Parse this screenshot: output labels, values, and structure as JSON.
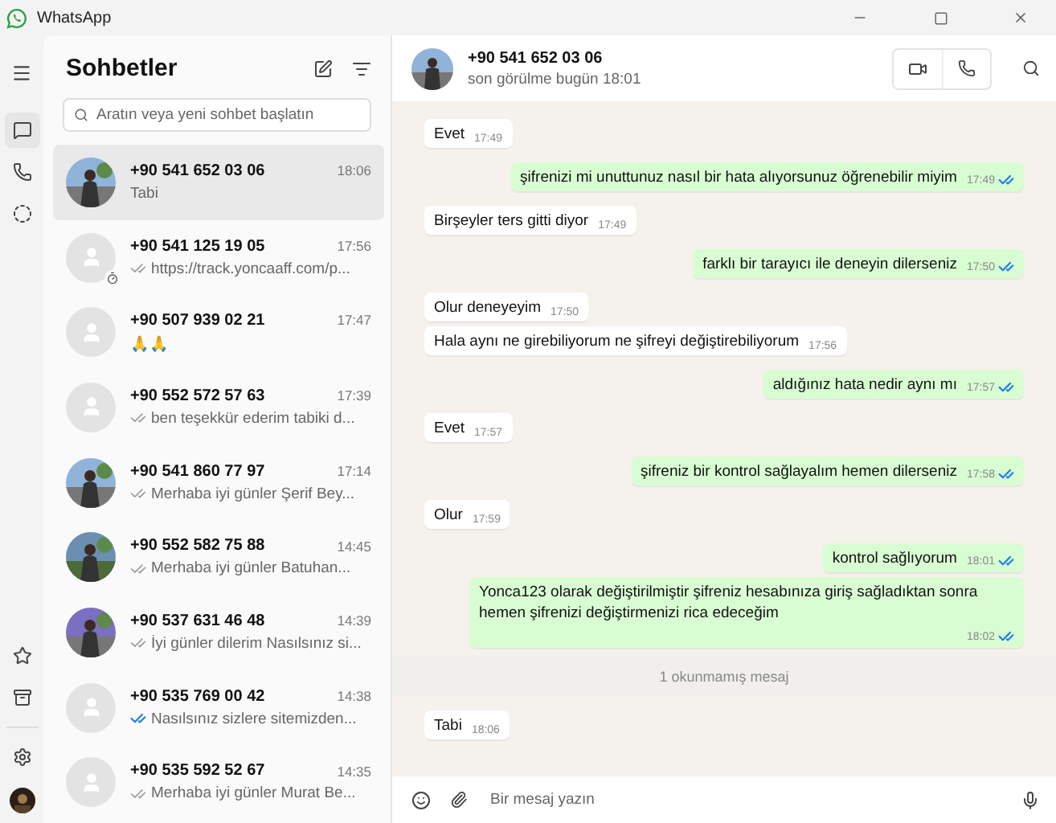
{
  "window": {
    "title": "WhatsApp"
  },
  "rail": {
    "items": [
      {
        "kind": "chats",
        "selected": true
      },
      {
        "kind": "calls",
        "selected": false
      },
      {
        "kind": "status",
        "selected": false
      }
    ]
  },
  "chat_list": {
    "title": "Sohbetler",
    "search": {
      "placeholder": "Aratın veya yeni sohbet başlatın"
    },
    "chats": [
      {
        "name": "+90 541 652 03 06",
        "time": "18:06",
        "preview": "Tabi",
        "ticks": false,
        "read": false,
        "has_photo": true,
        "timer": false,
        "selected": true
      },
      {
        "name": "+90 541 125 19 05",
        "time": "17:56",
        "preview": "https://track.yoncaaff.com/p...",
        "ticks": true,
        "read": false,
        "has_photo": false,
        "timer": true,
        "selected": false
      },
      {
        "name": "+90 507 939 02 21",
        "time": "17:47",
        "preview": "🙏🙏",
        "ticks": false,
        "read": false,
        "has_photo": false,
        "timer": false,
        "selected": false
      },
      {
        "name": "+90 552 572 57 63",
        "time": "17:39",
        "preview": "ben teşekkür ederim tabiki d...",
        "ticks": true,
        "read": false,
        "has_photo": false,
        "timer": false,
        "selected": false
      },
      {
        "name": "+90 541 860 77 97",
        "time": "17:14",
        "preview": "Merhaba iyi günler Şerif Bey...",
        "ticks": true,
        "read": false,
        "has_photo": true,
        "timer": false,
        "selected": false
      },
      {
        "name": "+90 552 582 75 88",
        "time": "14:45",
        "preview": "Merhaba iyi günler  Batuhan...",
        "ticks": true,
        "read": false,
        "has_photo": true,
        "timer": false,
        "selected": false
      },
      {
        "name": "+90 537 631 46 48",
        "time": "14:39",
        "preview": "İyi günler dilerim Nasılsınız si...",
        "ticks": true,
        "read": false,
        "has_photo": true,
        "timer": false,
        "selected": false
      },
      {
        "name": "+90 535 769 00 42",
        "time": "14:38",
        "preview": "Nasılsınız sizlere sitemizden...",
        "ticks": true,
        "read": true,
        "has_photo": false,
        "timer": false,
        "selected": false
      },
      {
        "name": "+90 535 592 52 67",
        "time": "14:35",
        "preview": "Merhaba iyi günler Murat Be...",
        "ticks": true,
        "read": false,
        "has_photo": false,
        "timer": false,
        "selected": false
      }
    ]
  },
  "conversation": {
    "name": "+90 541 652 03 06",
    "status": "son görülme bugün 18:01",
    "messages": [
      {
        "kind": "in",
        "text": "Evet",
        "time": "17:49"
      },
      {
        "kind": "out",
        "text": "şifrenizi mi unuttunuz nasıl bir hata alıyorsunuz öğrenebilir miyim",
        "time": "17:49",
        "read": true
      },
      {
        "kind": "in",
        "text": "Birşeyler ters gitti diyor",
        "time": "17:49"
      },
      {
        "kind": "out",
        "text": "farklı bir tarayıcı ile deneyin dilerseniz",
        "time": "17:50",
        "read": true
      },
      {
        "kind": "in",
        "text": "Olur deneyeyim",
        "time": "17:50"
      },
      {
        "kind": "in",
        "text": "Hala aynı ne girebiliyorum ne şifreyi değiştirebiliyorum",
        "time": "17:56"
      },
      {
        "kind": "out",
        "text": "aldığınız hata nedir aynı mı",
        "time": "17:57",
        "read": true
      },
      {
        "kind": "in",
        "text": "Evet",
        "time": "17:57"
      },
      {
        "kind": "out",
        "text": "şifreniz bir kontrol sağlayalım hemen dilerseniz",
        "time": "17:58",
        "read": true
      },
      {
        "kind": "in",
        "text": "Olur",
        "time": "17:59"
      },
      {
        "kind": "out",
        "text": "kontrol sağlıyorum",
        "time": "18:01",
        "read": true
      },
      {
        "kind": "out",
        "text": "Yonca123 olarak değiştirilmiştir şifreniz hesabınıza giriş sağladıktan sonra hemen şifrenizi değiştirmenizi rica edeceğim",
        "time": "18:02",
        "read": true
      },
      {
        "kind": "divider",
        "text": "1 okunmamış mesaj"
      },
      {
        "kind": "in",
        "text": "Tabi",
        "time": "18:06"
      }
    ],
    "composer": {
      "placeholder": "Bir mesaj yazın"
    }
  }
}
